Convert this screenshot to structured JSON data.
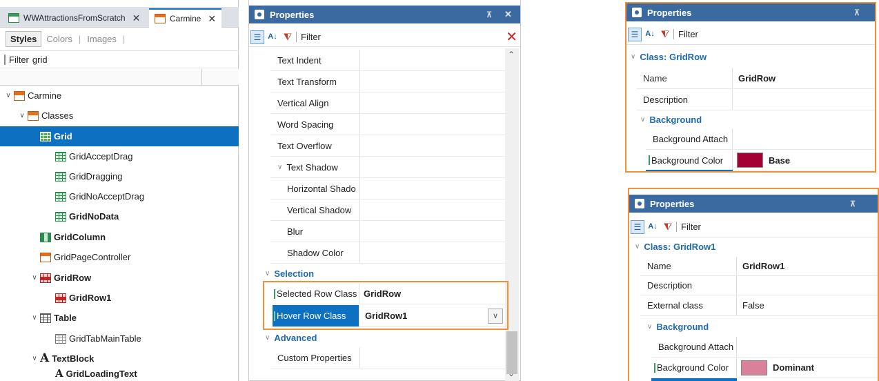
{
  "left_panel": {
    "doc_tabs": [
      {
        "label": "WWAttractionsFromScratch",
        "close": "✕"
      },
      {
        "label": "Carmine",
        "close": "✕"
      }
    ],
    "style_tabs": [
      "Styles",
      "Colors",
      "Images"
    ],
    "filter": {
      "label": "Filter",
      "value": "grid"
    },
    "tree": [
      {
        "label": "Carmine",
        "icon": "carmine-icon"
      },
      {
        "label": "Classes",
        "icon": "classes-icon"
      },
      {
        "label": "Grid",
        "icon": "grid-icon",
        "selected": true
      },
      {
        "label": "GridAcceptDrag",
        "icon": "grid-icon"
      },
      {
        "label": "GridDragging",
        "icon": "grid-icon"
      },
      {
        "label": "GridNoAcceptDrag",
        "icon": "grid-icon"
      },
      {
        "label": "GridNoData",
        "icon": "grid-icon"
      },
      {
        "label": "GridColumn",
        "icon": "grid-column-icon"
      },
      {
        "label": "GridPageController",
        "icon": "page-controller-icon"
      },
      {
        "label": "GridRow",
        "icon": "grid-row-icon"
      },
      {
        "label": "GridRow1",
        "icon": "grid-row-icon"
      },
      {
        "label": "Table",
        "icon": "table-icon"
      },
      {
        "label": "GridTabMainTable",
        "icon": "table-icon"
      },
      {
        "label": "TextBlock",
        "icon": "textblock-icon"
      },
      {
        "label": "GridLoadingText",
        "icon": "textblock-icon"
      }
    ]
  },
  "props_main": {
    "title": "Properties",
    "pin": "⊼",
    "close": "✕",
    "filter_label": "Filter",
    "clear": "✕",
    "rows": [
      {
        "name": "Text Indent",
        "value": ""
      },
      {
        "name": "Text Transform",
        "value": ""
      },
      {
        "name": "Vertical Align",
        "value": ""
      },
      {
        "name": "Word Spacing",
        "value": ""
      },
      {
        "name": "Text Overflow",
        "value": ""
      },
      {
        "name": "Text Shadow",
        "value": ""
      },
      {
        "name": "Horizontal Shado",
        "value": ""
      },
      {
        "name": "Vertical Shadow",
        "value": ""
      },
      {
        "name": "Blur",
        "value": ""
      },
      {
        "name": "Shadow Color",
        "value": ""
      }
    ],
    "section_selection": "Selection",
    "selected_row_class": {
      "name": "Selected Row Class",
      "value": "GridRow"
    },
    "hover_row_class": {
      "name": "Hover Row Class",
      "value": "GridRow1"
    },
    "section_advanced": "Advanced",
    "custom_properties": {
      "name": "Custom Properties",
      "value": ""
    }
  },
  "props_top": {
    "title": "Properties",
    "pin": "⊼",
    "filter_label": "Filter",
    "class_header": "Class: GridRow",
    "name_row": {
      "name": "Name",
      "value": "GridRow"
    },
    "description_row": {
      "name": "Description",
      "value": ""
    },
    "section_background": "Background",
    "bg_attach": {
      "name": "Background Attach",
      "value": ""
    },
    "bg_color": {
      "name": "Background Color",
      "value": "Base",
      "swatch": "#a50034"
    }
  },
  "props_bottom": {
    "title": "Properties",
    "pin": "⊼",
    "filter_label": "Filter",
    "class_header": "Class: GridRow1",
    "name_row": {
      "name": "Name",
      "value": "GridRow1"
    },
    "description_row": {
      "name": "Description",
      "value": ""
    },
    "external_row": {
      "name": "External class",
      "value": "False"
    },
    "section_background": "Background",
    "bg_attach": {
      "name": "Background Attach",
      "value": ""
    },
    "bg_color": {
      "name": "Background Color",
      "value": "Dominant",
      "swatch": "#d9819a"
    }
  }
}
